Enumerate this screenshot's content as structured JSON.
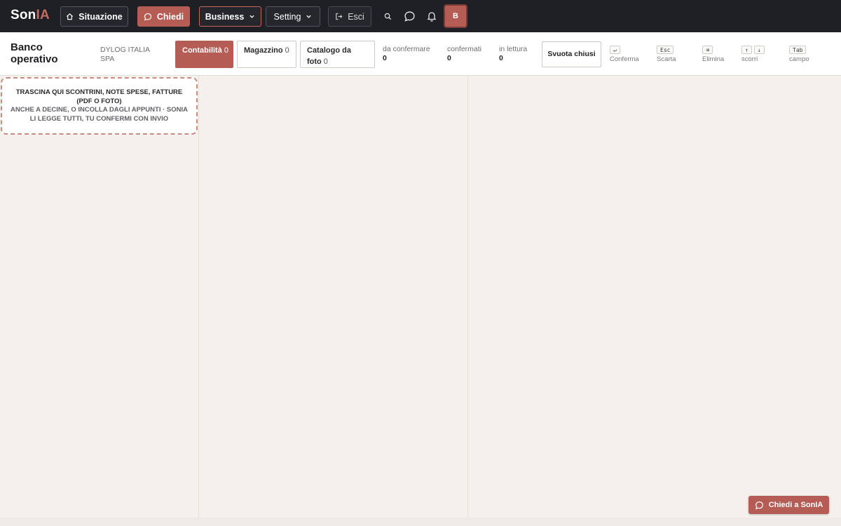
{
  "brand": {
    "logo_part1": "Son",
    "logo_part2": "IA",
    "accent_color": "#b55d55"
  },
  "nav": {
    "situazione": "Situazione",
    "chiedi": "Chiedi",
    "business": "Business",
    "setting": "Setting",
    "esci": "Esci",
    "icons": [
      "home-icon",
      "chat-icon",
      "chevron-down-icon",
      "logout-icon",
      "search-icon",
      "bell-icon"
    ],
    "avatar": "B"
  },
  "header": {
    "title": "Banco operativo",
    "company": "DYLOG ITALIA SPA",
    "tabs": [
      {
        "label": "Contabilità",
        "count": "0",
        "active": true
      },
      {
        "label": "Magazzino",
        "count": "0",
        "active": false
      },
      {
        "label": "Catalogo da foto",
        "count": "0",
        "active": false
      }
    ],
    "stats": [
      {
        "label": "da confermare",
        "value": "0"
      },
      {
        "label": "confermati",
        "value": "0"
      },
      {
        "label": "in lettura",
        "value": "0"
      }
    ],
    "svuota": "Svuota chiusi",
    "shortcuts": [
      {
        "keys": [
          "↵"
        ],
        "label": "Conferma"
      },
      {
        "keys": [
          "Esc"
        ],
        "label": "Scarta"
      },
      {
        "keys": [
          "⌫"
        ],
        "label": "Elimina"
      },
      {
        "keys": [
          "↑",
          "↓"
        ],
        "label": "scorri"
      },
      {
        "keys": [
          "Tab"
        ],
        "label": "campo"
      }
    ]
  },
  "dropzone": {
    "line1": "TRASCINA QUI SCONTRINI, NOTE SPESE, FATTURE (PDF O FOTO)",
    "line2": "ANCHE A DECINE, O INCOLLA DAGLI APPUNTI · SONIA LI LEGGE TUTTI, TU CONFERMI CON INVIO"
  },
  "ask_button": "Chiedi a SonIA"
}
